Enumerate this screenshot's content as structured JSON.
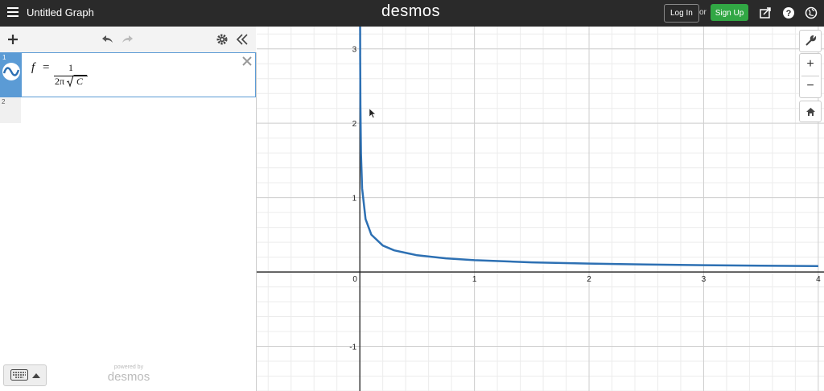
{
  "header": {
    "title": "Untitled Graph",
    "logo": "desmos",
    "login_label": "Log In",
    "or_label": "or",
    "signup_label": "Sign Up",
    "signup_color": "#31a744",
    "icons": [
      "share-icon",
      "help-icon",
      "globe-icon"
    ]
  },
  "toolbar": {
    "icons": [
      "plus-icon",
      "undo-icon",
      "redo-icon",
      "gear-icon",
      "collapse-icon"
    ]
  },
  "expressions": [
    {
      "index": "1",
      "lhs": "f",
      "equals": "=",
      "numerator": "1",
      "denominator_coef": "2π",
      "denominator_var": "C",
      "color": "#5b9bd5"
    },
    {
      "index": "2"
    }
  ],
  "footer": {
    "powered_by": "powered by",
    "brand": "desmos"
  },
  "graph_controls": {
    "zoom_in": "+",
    "zoom_out": "−"
  },
  "chart_data": {
    "type": "line",
    "function": "f = 1/(2π√C)",
    "series": [
      {
        "color": "#2d70b3",
        "x": [
          0.003,
          0.005,
          0.01,
          0.02,
          0.05,
          0.1,
          0.2,
          0.3,
          0.5,
          0.75,
          1,
          1.5,
          2,
          2.5,
          3,
          3.5,
          4
        ],
        "y": [
          2.906,
          2.251,
          1.592,
          1.125,
          0.712,
          0.503,
          0.356,
          0.291,
          0.225,
          0.184,
          0.159,
          0.13,
          0.113,
          0.101,
          0.092,
          0.085,
          0.08
        ]
      }
    ],
    "xlim": [
      -0.9,
      4.05
    ],
    "ylim": [
      -1.6,
      3.3
    ],
    "x_ticks": [
      "0",
      "1",
      "2",
      "3",
      "4"
    ],
    "y_ticks": [
      "3",
      "2",
      "1",
      "-1"
    ],
    "grid": true
  }
}
